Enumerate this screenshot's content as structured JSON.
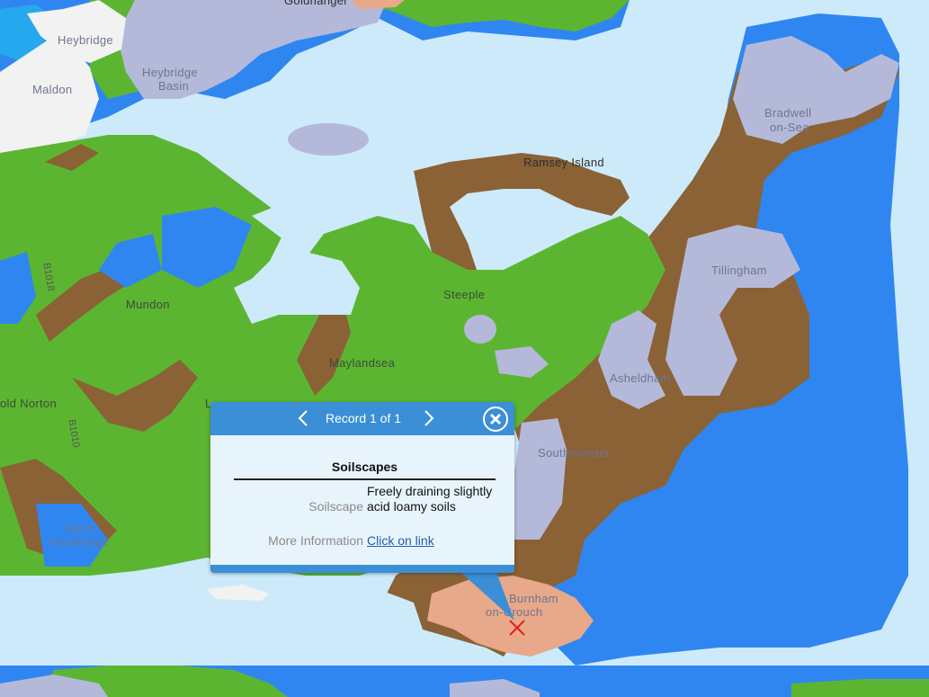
{
  "map": {
    "colors": {
      "water": "#cdeafb",
      "wet_soil": "#2f86f0",
      "loamy_green": "#5cb531",
      "brown_loam": "#8a6235",
      "lavender_clay": "#b4b9da",
      "urban": "#f2f2f2",
      "sandy_salmon": "#e8a88a",
      "lake": "#25a8ee"
    },
    "places": [
      "Heybridge",
      "Maldon",
      "Heybridge",
      "Basin",
      "Goldhanger",
      "Bradwell",
      "on-Sea",
      "Ramsey Island",
      "Tillingham",
      "Steeple",
      "Mundon",
      "Maylandsea",
      "Asheldham",
      "old Norton",
      "L",
      "Southminster",
      "North",
      "Fambridge",
      "Burnham",
      "on-Crouch"
    ],
    "roads": [
      "B1018",
      "B1010"
    ]
  },
  "popup": {
    "record_label": "Record 1 of 1",
    "title": "Soilscapes",
    "fields": {
      "soilscape_label": "Soilscape",
      "soilscape_value": "Freely draining slightly acid loamy soils",
      "more_label": "More Information",
      "more_link": "Click on link"
    }
  }
}
